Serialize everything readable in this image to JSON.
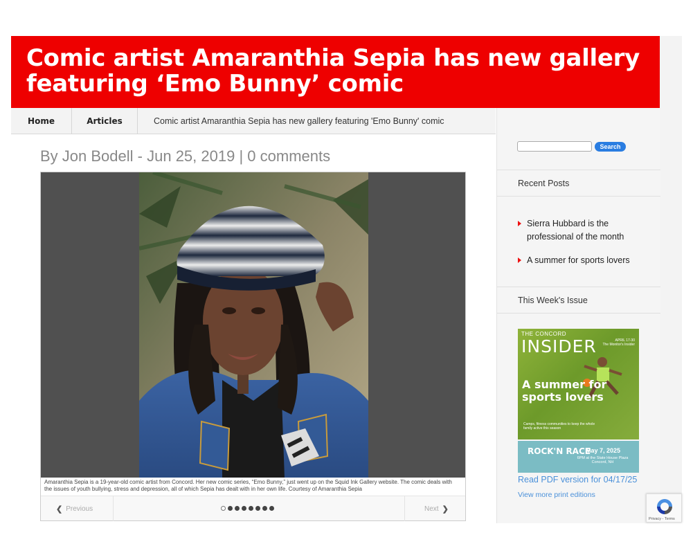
{
  "article": {
    "title": "Comic artist Amaranthia Sepia has new gallery featuring ‘Emo Bunny’ comic",
    "byline_prefix": "By ",
    "author": "Jon Bodell",
    "date_separator": " - ",
    "date": "Jun 25, 2019",
    "comments_separator": " | ",
    "comments": "0 comments"
  },
  "nav": {
    "home": "Home",
    "articles": "Articles",
    "breadcrumb": "Comic artist Amaranthia Sepia has new gallery featuring 'Emo Bunny' comic"
  },
  "slider": {
    "caption": "Amaranthia Sepia is a 19-year-old comic artist from Concord. Her new comic series, “Emo Bunny,” just went up on the Squid Ink Gallery website. The comic deals with the issues of youth bullying, stress and depression, all of which Sepia has dealt with in her own life. Courtesy of Amaranthia Sepia",
    "prev_label": "Previous",
    "next_label": "Next",
    "slide_count": 8,
    "active_slide": 1
  },
  "sidebar": {
    "search_placeholder": "",
    "search_button": "Search",
    "recent_posts_title": "Recent Posts",
    "recent_posts": [
      "Sierra Hubbard is the professional of the month",
      "A summer for sports lovers"
    ],
    "issue_title": "This Week's Issue",
    "cover": {
      "mast_small": "THE CONCORD",
      "mast": "INSIDER",
      "date": "APRIL 17-30\nThe Monitor's Insider",
      "headline": "A summer for sports lovers",
      "deck": "Camps, fitness communities to keep the whole family active this season",
      "ad_title": "ROCK'N RACE",
      "ad_date": "May 7, 2025",
      "ad_location": "6PM at the State House Plaza Concord, NH"
    },
    "pdf_link": "Read PDF version for 04/17/25",
    "more_link": "View more print editions"
  },
  "recaptcha": {
    "label": "Privacy - Terms"
  },
  "colors": {
    "banner_red": "#ee0000",
    "link_blue": "#4a90d9",
    "button_blue": "#2a7de1",
    "bullet_red": "#ee1111"
  }
}
